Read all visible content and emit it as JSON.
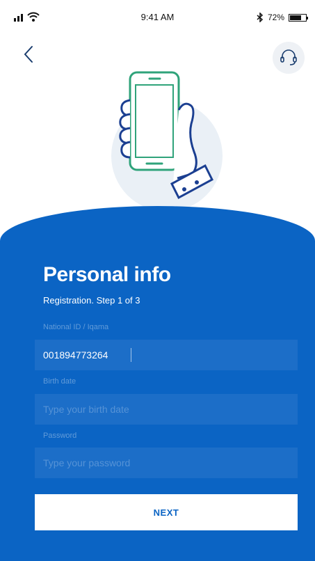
{
  "status_bar": {
    "time": "9:41 AM",
    "battery_percent": "72%",
    "battery_level": 0.72
  },
  "header": {
    "back_icon": "chevron-left-icon",
    "support_icon": "headset-icon"
  },
  "illustration": {
    "icon": "phone-in-hand-icon"
  },
  "form": {
    "title": "Personal info",
    "subtitle": "Registration. Step 1 of 3",
    "fields": [
      {
        "label": "National ID / Iqama",
        "value": "001894773264",
        "placeholder": ""
      },
      {
        "label": "Birth date",
        "value": "",
        "placeholder": "Type your birth date"
      },
      {
        "label": "Password",
        "value": "",
        "placeholder": "Type your password"
      }
    ],
    "submit_label": "NEXT"
  },
  "colors": {
    "primary": "#0b64c4",
    "accent": "#2fa37a",
    "background": "#ffffff"
  }
}
